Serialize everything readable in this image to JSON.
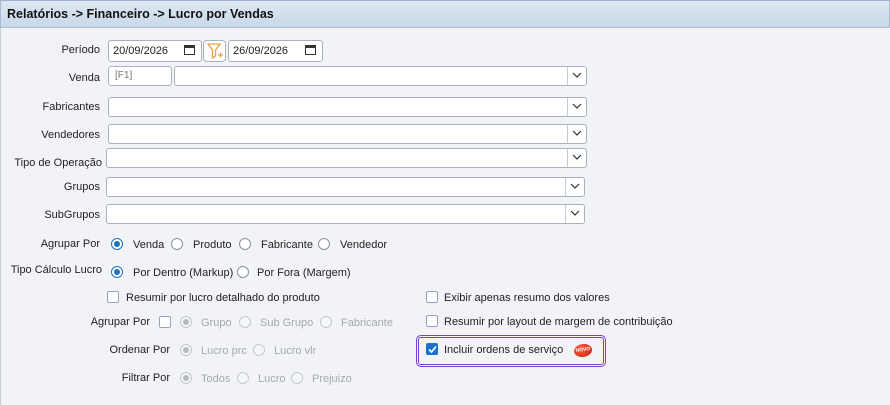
{
  "header": {
    "breadcrumb": "Relatórios -> Financeiro -> Lucro por Vendas"
  },
  "form": {
    "periodo": {
      "label": "Período",
      "start": "20/09/2026",
      "end": "26/09/2026"
    },
    "venda": {
      "label": "Venda",
      "code_placeholder": "[F1]",
      "value": ""
    },
    "fabricantes": {
      "label": "Fabricantes",
      "value": ""
    },
    "vendedores": {
      "label": "Vendedores",
      "value": ""
    },
    "tipo_operacao": {
      "label": "Tipo de Operação",
      "value": ""
    },
    "grupos": {
      "label": "Grupos",
      "value": ""
    },
    "subgrupos": {
      "label": "SubGrupos",
      "value": ""
    },
    "agrupar_por": {
      "label": "Agrupar Por",
      "options": [
        "Venda",
        "Produto",
        "Fabricante",
        "Vendedor"
      ],
      "selected": "Venda"
    },
    "tipo_calculo": {
      "label": "Tipo Cálculo Lucro",
      "options": [
        "Por Dentro (Markup)",
        "Por Fora (Margem)"
      ],
      "selected": "Por Dentro (Markup)"
    },
    "resumir_detalhado": {
      "label": "Resumir por lucro detalhado do produto",
      "checked": false
    },
    "exibir_resumo": {
      "label": "Exibir apenas resumo dos valores",
      "checked": false
    },
    "resumir_layout": {
      "label": "Resumir por layout de margem de contribuição",
      "checked": false
    },
    "incluir_os": {
      "label": "Incluir ordens de serviço",
      "checked": true,
      "badge": "NOVO"
    },
    "agrupar_por_2": {
      "label": "Agrupar Por",
      "checked": false,
      "options": [
        "Grupo",
        "Sub Grupo",
        "Fabricante"
      ],
      "selected": "Grupo"
    },
    "ordenar_por": {
      "label": "Ordenar Por",
      "options": [
        "Lucro prc",
        "Lucro vlr"
      ],
      "selected": "Lucro prc"
    },
    "filtrar_por": {
      "label": "Filtrar Por",
      "options": [
        "Todos",
        "Lucro",
        "Prejuizo"
      ],
      "selected": "Todos"
    }
  },
  "colors": {
    "accent": "#1a73c8",
    "highlight": "#7a3fd1",
    "filter_icon": "#e8a33a"
  }
}
